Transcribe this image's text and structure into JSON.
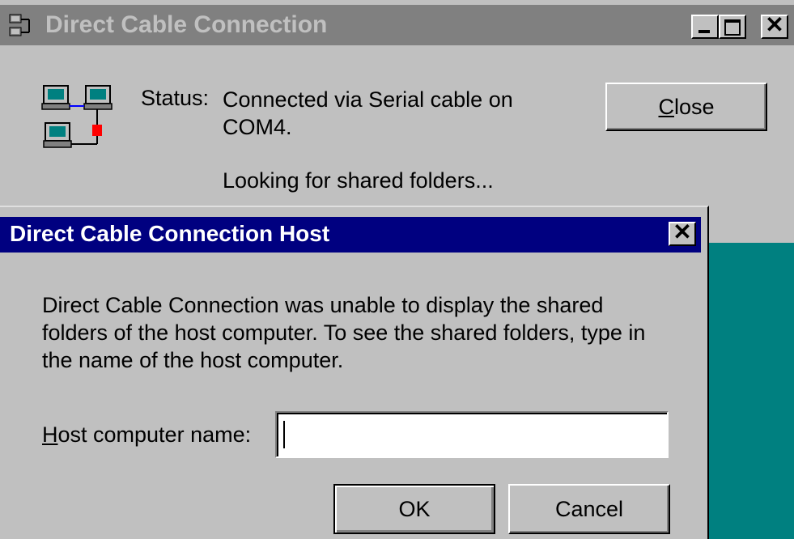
{
  "back_window": {
    "title": "Direct Cable Connection",
    "status_label": "Status:",
    "status_text": "Connected via Serial cable on COM4.",
    "looking_text": "Looking for shared folders...",
    "close_button": {
      "mnemonic": "C",
      "rest": "lose"
    }
  },
  "host_dialog": {
    "title": "Direct Cable Connection Host",
    "message": "Direct Cable Connection was unable to display the shared folders of the host computer. To see the shared folders, type in the name of the host computer.",
    "host_label": {
      "mnemonic": "H",
      "rest": "ost computer name:"
    },
    "host_input_value": "",
    "ok_label": "OK",
    "cancel_label": "Cancel"
  },
  "colors": {
    "desktop": "#008080",
    "active_titlebar": "#000080",
    "inactive_titlebar": "#808080",
    "face": "#c0c0c0"
  },
  "icons": {
    "app": "network-computers-icon",
    "connection": "cable-connection-icon"
  }
}
